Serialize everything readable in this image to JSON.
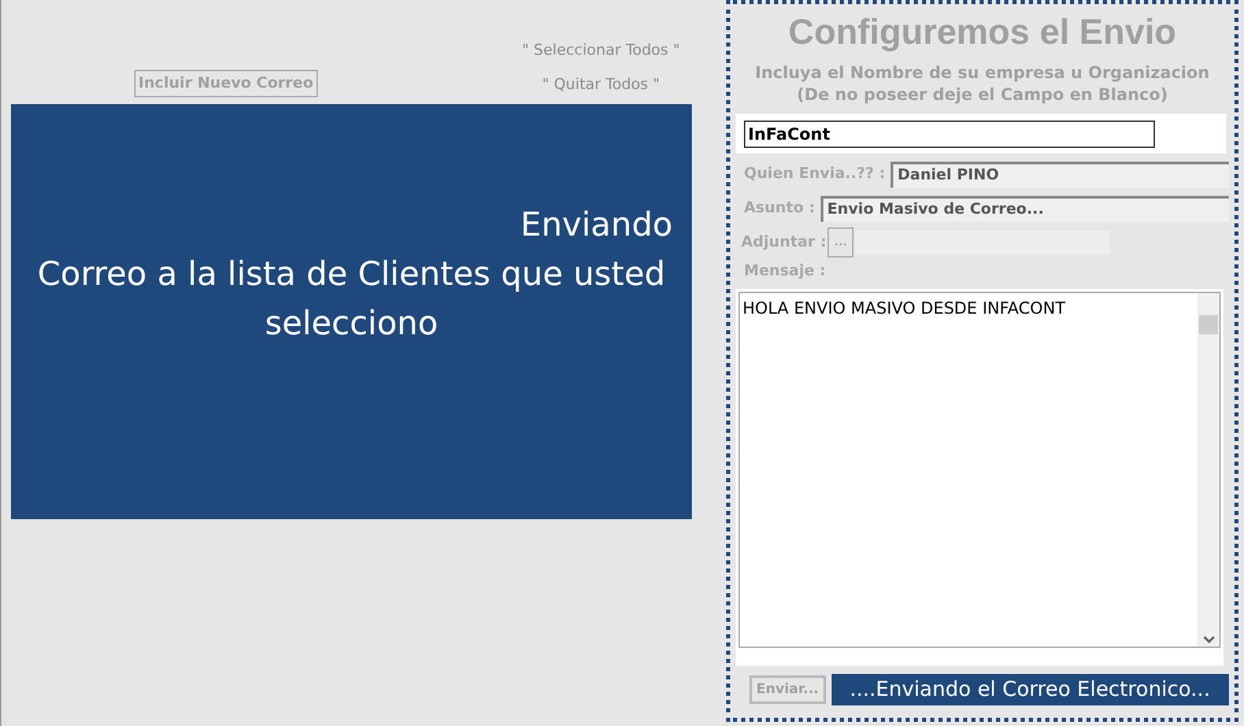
{
  "left": {
    "links": [
      "\" Seleccionar Todos \"",
      "\" Quitar Todos \""
    ],
    "add_button": {
      "label": "Incluir Nuevo Correo",
      "disabled": true
    },
    "banner": {
      "status": "Enviando",
      "message": "Correo a la lista de Clientes que usted selecciono"
    }
  },
  "form": {
    "title": "Configuremos el Envio",
    "company_hint": "Incluya el Nombre de su empresa u Organizacion          (De no poseer deje el Campo en Blanco)",
    "company": {
      "value": "InFaCont"
    },
    "fields": [
      {
        "label": "Quien Envia..?? :",
        "value": "Daniel PINO"
      },
      {
        "label": "Asunto :",
        "value": "Envio Masivo de Correo..."
      }
    ],
    "attach": {
      "label": "Adjuntar :",
      "button": "..."
    },
    "message": {
      "label": "Mensaje  :",
      "value": "HOLA ENVIO MASIVO DESDE INFACONT"
    },
    "send_button": {
      "label": "Enviar...",
      "disabled": true
    },
    "status": "....Enviando el Correo Electronico..."
  }
}
